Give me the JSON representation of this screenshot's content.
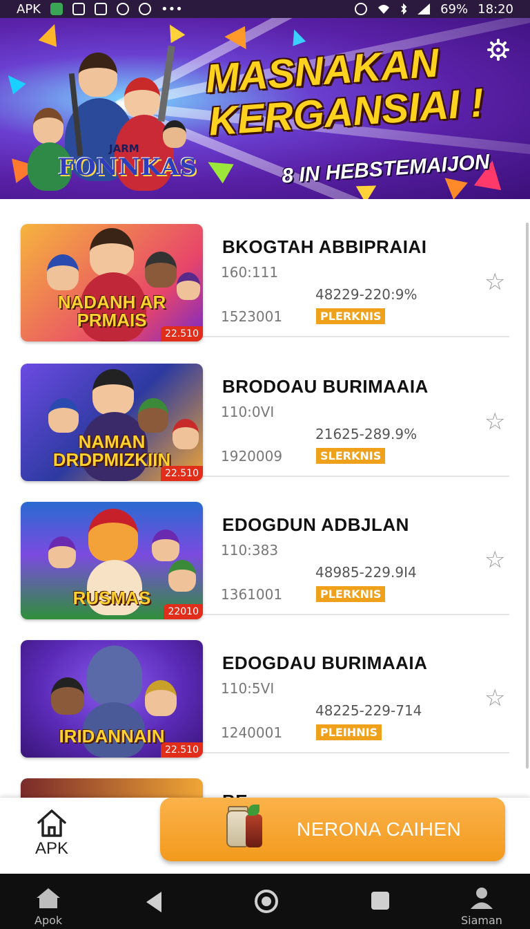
{
  "status_bar": {
    "left_label": "APK",
    "battery": "69%",
    "time": "18:20",
    "more": "•••"
  },
  "banner": {
    "title_line1": "MASNAKAN",
    "title_line2": "KERGANSIAI !",
    "subtitle": "8 IN HEBSTEMAIJON",
    "logo_small": "JARM",
    "logo": "FONNKAS",
    "settings_icon": "gear-icon"
  },
  "items": [
    {
      "title": "BKOGTAH ABBIPRAIAI",
      "num1": "160:111",
      "range": "48229-220:9%",
      "num2": "1523001",
      "tag": "PLERKNIS",
      "thumb_title": "NADANH AR PRMAIS",
      "thumb_badge": "22.510",
      "thumb_bg": [
        "#f4a83a",
        "#e23b6a"
      ]
    },
    {
      "title": "BRODOAU BURIMAAIA",
      "num1": "110:0VI",
      "range": "21625-289.9%",
      "num2": "1920009",
      "tag": "SLERKNIS",
      "thumb_title": "NAMAN DRDPMIZKIIN",
      "thumb_badge": "22.510",
      "thumb_bg": [
        "#6a4be0",
        "#f0a636"
      ]
    },
    {
      "title": "EDOGDUN ADBJLAN",
      "num1": "110:383",
      "range": "48985-229.9I4",
      "num2": "1361001",
      "tag": "PLERKNIS",
      "thumb_title": "RUSMAS",
      "thumb_badge": "22010",
      "thumb_bg": [
        "#2f8f3a",
        "#7b4be0"
      ]
    },
    {
      "title": "EDOGDAU BURIMAAIA",
      "num1": "110:5VI",
      "range": "48225-229-714",
      "num2": "1240001",
      "tag": "PLEIHNIS",
      "thumb_title": "IRIDANNAIN",
      "thumb_badge": "22.510",
      "thumb_bg": [
        "#5b2bb8",
        "#e04a8a"
      ]
    },
    {
      "title": "BE",
      "num1": "",
      "range": "",
      "num2": "",
      "tag": "",
      "thumb_title": "",
      "thumb_badge": "",
      "thumb_bg": [
        "#7a2a2a",
        "#f0a636"
      ]
    }
  ],
  "bottom": {
    "apk_label": "APK",
    "cta_label": "NERONA CAIHEN"
  },
  "navbar": {
    "left_label": "Apok",
    "right_label": "Siaman"
  },
  "colors": {
    "accent": "#f29a1d",
    "tag": "#f0a11c",
    "banner_purple": "#5a21a8",
    "title_yellow": "#ffd21f"
  }
}
